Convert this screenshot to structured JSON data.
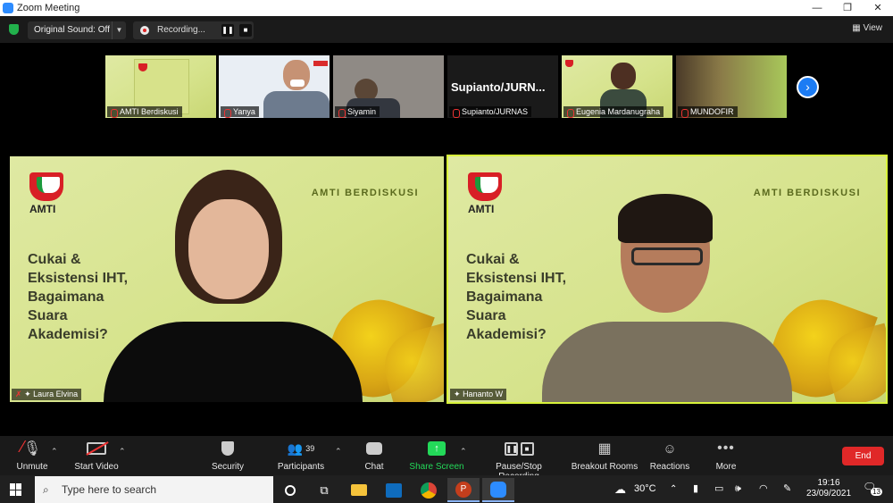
{
  "window": {
    "title": "Zoom Meeting",
    "controls": [
      "—",
      "❐",
      "✕"
    ]
  },
  "topbar": {
    "original_sound": "Original Sound: Off",
    "recording": "Recording...",
    "view": "View"
  },
  "thumbnails": [
    {
      "name": "AMTI Berdiskusi"
    },
    {
      "name": "Yanya"
    },
    {
      "name": "Siyamin"
    },
    {
      "name": "Supianto/JURNAS",
      "banner": "Supianto/JURN..."
    },
    {
      "name": "Eugenia Mardanugraha"
    },
    {
      "name": "MUNDOFIR"
    }
  ],
  "slide": {
    "heading": "AMTI BERDISKUSI",
    "logo_text": "AMTI",
    "title_lines": [
      "Cukai &",
      "Eksistensi IHT,",
      "Bagaimana",
      "Suara",
      "Akademisi?"
    ]
  },
  "videos": [
    {
      "name": "Laura Elvina"
    },
    {
      "name": "Hananto W"
    }
  ],
  "toolbar": {
    "unmute": "Unmute",
    "start_video": "Start Video",
    "security": "Security",
    "participants": "Participants",
    "participants_count": "39",
    "chat": "Chat",
    "share_screen": "Share Screen",
    "pause_stop": "Pause/Stop Recording",
    "breakout": "Breakout Rooms",
    "reactions": "Reactions",
    "more": "More",
    "end": "End"
  },
  "taskbar": {
    "search_placeholder": "Type here to search",
    "weather": "30°C",
    "time": "19:16",
    "date": "23/09/2021",
    "notifications": "13"
  },
  "colors": {
    "accent": "#2d8cff",
    "end_red": "#e02828",
    "share_green": "#23d959",
    "slide_bg": "#d6e38c",
    "active_speaker": "#d8f33a"
  }
}
